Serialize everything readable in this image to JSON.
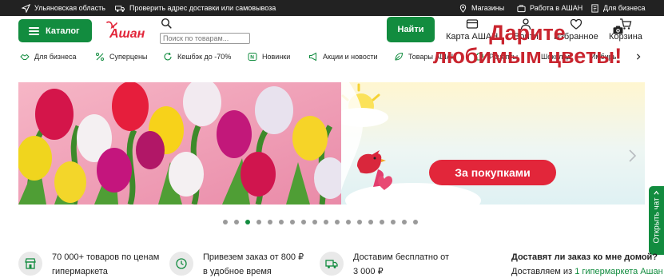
{
  "topbar": {
    "region": "Ульяновская область",
    "check_address": "Проверить адрес доставки или самовывоза",
    "stores": "Магазины",
    "jobs": "Работа в АШАН",
    "business": "Для бизнеса"
  },
  "header": {
    "catalog_label": "Каталог",
    "logo_text": "Ашан",
    "search_placeholder": "Поиск по товарам...",
    "find_label": "Найти",
    "nav": [
      "Карта АШАН",
      "Войти",
      "Избранное",
      "Корзина"
    ]
  },
  "categories": [
    "Для бизнеса",
    "Суперцены",
    "Кешбэк до -70%",
    "Новинки",
    "Акции и новости",
    "Товары АШАН",
    "Рецепты",
    "Шоколад",
    "Имбирь"
  ],
  "banner": {
    "title_line1": "Дарите",
    "title_line2": "любимым цветы!",
    "button_label": "За покупками"
  },
  "carousel": {
    "count": 18,
    "active_index": 2
  },
  "chat": {
    "label": "Открыть чат"
  },
  "features": [
    {
      "line1": "70 000+ товаров по ценам",
      "line2": "гипермаркета",
      "icon": "store-icon"
    },
    {
      "line1": "Привезем заказ от 800 ₽",
      "line2": "в удобное время",
      "icon": "clock-icon"
    },
    {
      "line1": "Доставим бесплатно от",
      "line2": "3 000 ₽",
      "icon": "truck-icon"
    }
  ],
  "delivery_question": {
    "title": "Доставят ли заказ ко мне домой?",
    "text": "Доставляем из",
    "link": "1 гипермаркета Ашан"
  },
  "colors": {
    "brand_green": "#128c3f",
    "brand_red": "#e2263a",
    "topbar_bg": "#222222"
  }
}
